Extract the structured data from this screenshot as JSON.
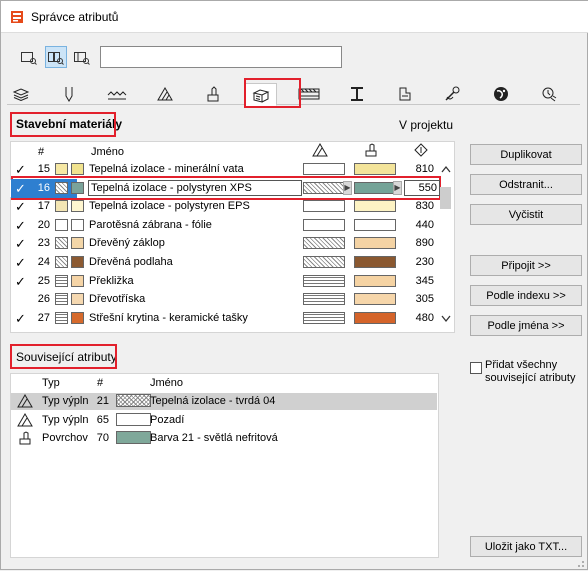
{
  "window": {
    "title": "Správce atributů"
  },
  "search": {
    "value": ""
  },
  "view_buttons": [
    "list-view-icon",
    "pair-view-icon",
    "single-view-icon"
  ],
  "tabs": [
    {
      "icon": "layers-icon"
    },
    {
      "icon": "pen-icon"
    },
    {
      "icon": "line-type-icon"
    },
    {
      "icon": "fill-icon"
    },
    {
      "icon": "surface-icon"
    },
    {
      "icon": "building-material-icon",
      "selected": true
    },
    {
      "icon": "composite-icon"
    },
    {
      "icon": "profile-icon"
    },
    {
      "icon": "zone-category-icon"
    },
    {
      "icon": "mep-icon"
    },
    {
      "icon": "markup-icon"
    },
    {
      "icon": "operation-profile-icon"
    }
  ],
  "materials": {
    "section_title": "Stavební materiály",
    "filter_label": "V projektu",
    "columns": {
      "number": "#",
      "name": "Jméno"
    },
    "rows": [
      {
        "check": "✓",
        "num": "15",
        "name": "Tepelná izolace - minerální vata",
        "sw": "#f6e8a4",
        "sw2": "#f1e38e",
        "fill": "#ffffff",
        "fill_hatch": "none",
        "surface": "#f3e49a",
        "value": "810"
      },
      {
        "check": "✓",
        "num": "16",
        "name": "Tepelná izolace - polystyren XPS",
        "sw": "#f2dc98",
        "sw2": "#7aa39a",
        "fill": "#f6e4ac",
        "fill_hatch": "diag",
        "surface": "#74a397",
        "value": "550",
        "selected": true
      },
      {
        "check": "✓",
        "num": "17",
        "name": "Tepelná izolace - polystyren EPS",
        "sw": "#f4e6b4",
        "sw2": "#fff6d0",
        "fill": "#ffffff",
        "fill_hatch": "none",
        "surface": "#fdf3c4",
        "value": "830"
      },
      {
        "check": "✓",
        "num": "20",
        "name": "Parotěsná zábrana - fólie",
        "sw": "#ffffff",
        "sw2": "#ffffff",
        "fill": "#ffffff",
        "fill_hatch": "none",
        "surface": "#ffffff",
        "value": "440"
      },
      {
        "check": "✓",
        "num": "23",
        "name": "Dřevěný záklop",
        "sw": "#e9d0a8",
        "sw2": "#f3d6a8",
        "fill": "#e8c89a",
        "fill_hatch": "diag",
        "surface": "#f4d3a4",
        "value": "890"
      },
      {
        "check": "✓",
        "num": "24",
        "name": "Dřevěná podlaha",
        "sw": "#e0c7a0",
        "sw2": "#8c5a32",
        "fill": "#e0c090",
        "fill_hatch": "diag",
        "surface": "#8a5830",
        "value": "230"
      },
      {
        "check": "✓",
        "num": "25",
        "name": "Překližka",
        "sw": "#f0d7ad",
        "sw2": "#f5d4a6",
        "fill": "#f0d4a8",
        "fill_hatch": "h",
        "surface": "#f5d3a3",
        "value": "345"
      },
      {
        "check": "",
        "num": "26",
        "name": "Dřevotříska",
        "sw": "#efd8b0",
        "sw2": "#f5d8b0",
        "fill": "#eedbb4",
        "fill_hatch": "h",
        "surface": "#f6d6aa",
        "value": "305"
      },
      {
        "check": "✓",
        "num": "27",
        "name": "Střešní krytina - keramické tašky",
        "sw": "#cfcfcf",
        "sw2": "#d66a2c",
        "fill": "#cccccc",
        "fill_hatch": "h",
        "surface": "#d4642a",
        "value": "480"
      }
    ]
  },
  "buttons": {
    "duplicate": "Duplikovat",
    "remove": "Odstranit...",
    "clear": "Vyčistit",
    "attach": "Připojit >>",
    "by_index": "Podle indexu >>",
    "by_name": "Podle jména >>",
    "save_txt": "Uložit jako TXT..."
  },
  "related": {
    "section_title": "Související atributy",
    "columns": {
      "type": "Typ",
      "number": "#",
      "name": "Jméno"
    },
    "rows": [
      {
        "icon": "fill-type-icon",
        "type": "Typ výpln",
        "num": "21",
        "name": "Tepelná izolace - tvrdá 04",
        "swatch": "#ffffff",
        "hatch": "cross",
        "selected": true
      },
      {
        "icon": "fill-type-icon",
        "type": "Typ výpln",
        "num": "65",
        "name": "Pozadí",
        "swatch": "#ffffff",
        "hatch": "none"
      },
      {
        "icon": "surface-type-icon",
        "type": "Povrchov",
        "num": "70",
        "name": "Barva 21 - světlá nefritová",
        "swatch": "#7fa89a",
        "hatch": "none"
      }
    ],
    "add_all_label": "Přidat všechny související atributy",
    "add_all_checked": false
  }
}
